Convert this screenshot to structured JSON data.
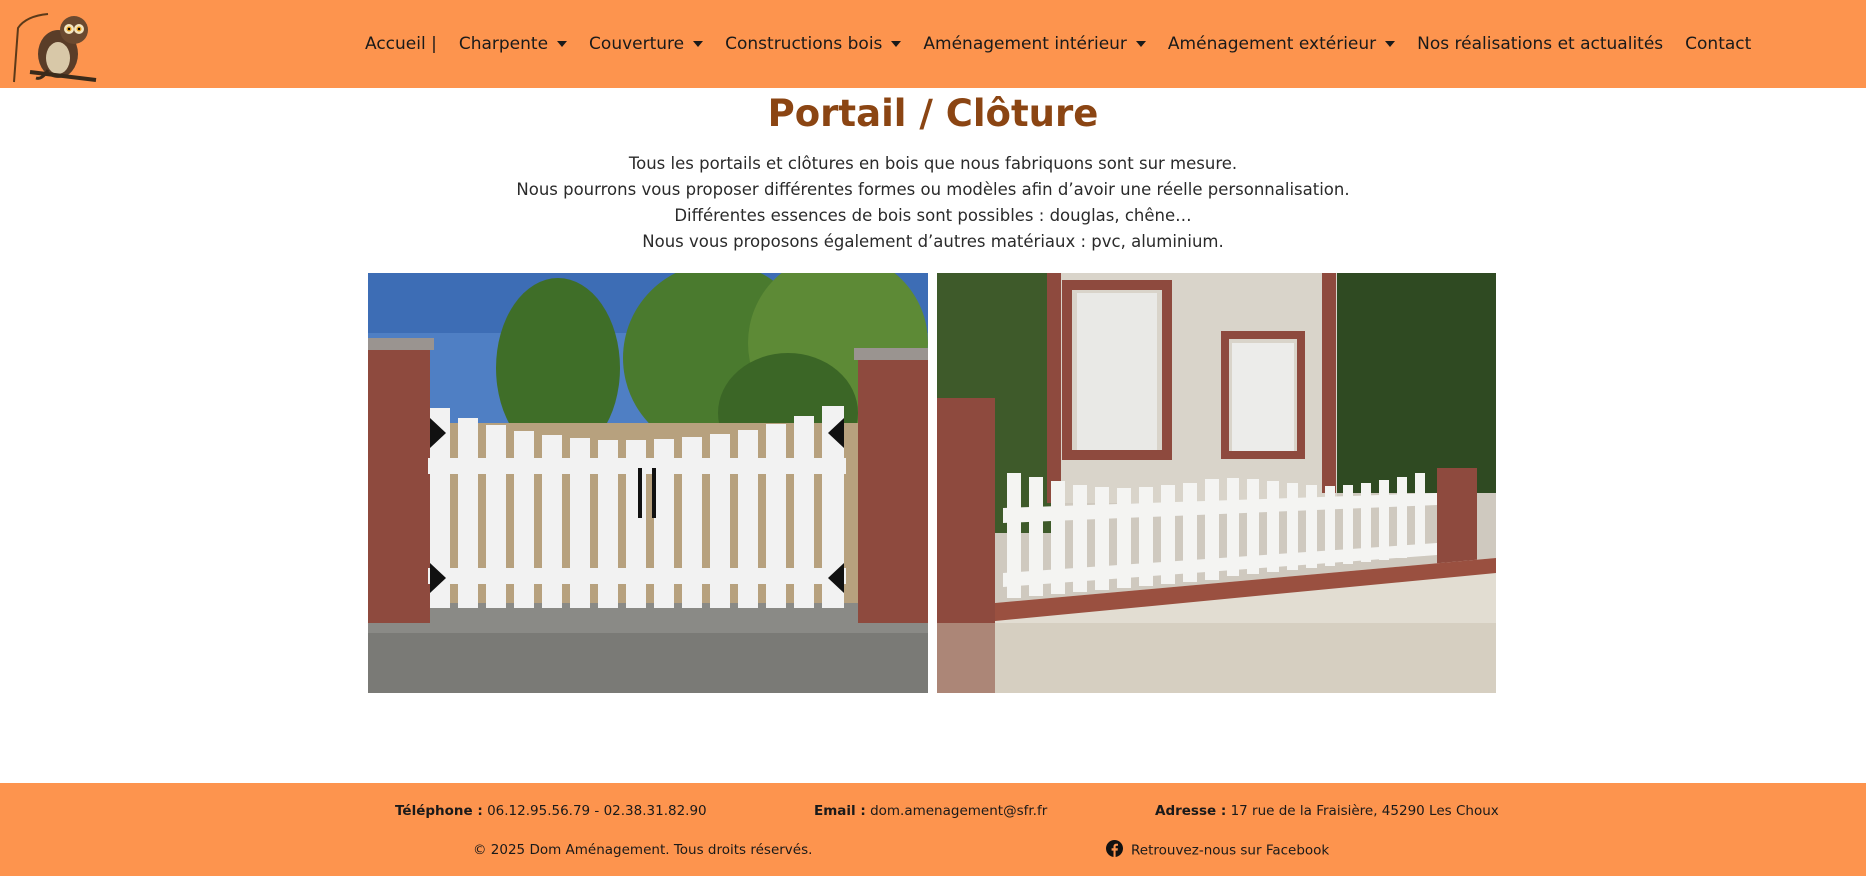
{
  "nav": {
    "logo_icon": "owl-logo",
    "items": [
      {
        "label": "Accueil |",
        "dropdown": false
      },
      {
        "label": "Charpente",
        "dropdown": true
      },
      {
        "label": "Couverture",
        "dropdown": true
      },
      {
        "label": "Constructions bois",
        "dropdown": true
      },
      {
        "label": "Aménagement intérieur",
        "dropdown": true
      },
      {
        "label": "Aménagement extérieur",
        "dropdown": true
      },
      {
        "label": "Nos réalisations et actualités",
        "dropdown": false
      },
      {
        "label": "Contact",
        "dropdown": false
      }
    ]
  },
  "page": {
    "title": "Portail / Clôture",
    "intro": [
      "Tous les portails et clôtures en bois que nous fabriquons sont sur mesure.",
      "Nous pourrons vous proposer différentes formes ou modèles afin d’avoir une réelle personnalisation.",
      "Différentes essences de bois sont possibles : douglas, chêne…",
      "Nous vous proposons également d’autres matériaux : pvc, aluminium."
    ]
  },
  "footer": {
    "phone_label": "Téléphone :",
    "phone_value": "06.12.95.56.79 - 02.38.31.82.90",
    "email_label": "Email :",
    "email_value": "dom.amenagement@sfr.fr",
    "address_label": "Adresse :",
    "address_value": "17 rue de la Fraisière, 45290 Les Choux",
    "copyright": "© 2025 Dom Aménagement. Tous droits réservés.",
    "facebook_icon": "facebook-icon",
    "facebook_text": "Retrouvez-nous sur Facebook"
  },
  "colors": {
    "header_bg": "#fd944e",
    "title": "#8b4513",
    "footer_bg": "#fd944e"
  }
}
